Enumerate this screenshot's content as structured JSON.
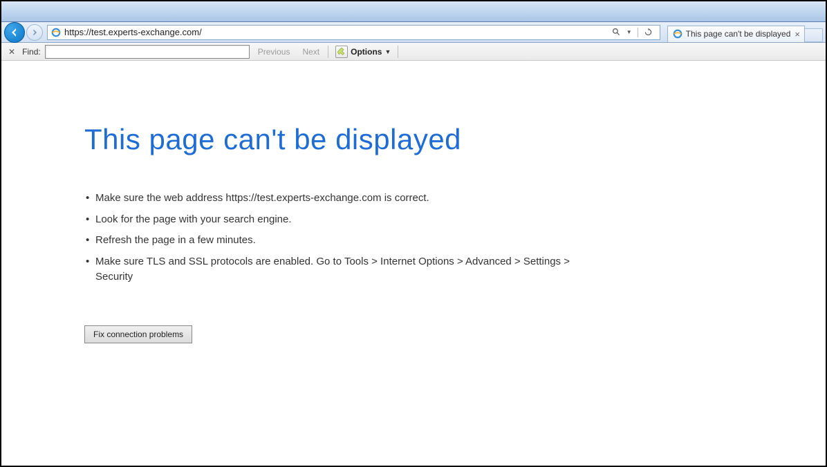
{
  "nav": {
    "url": "https://test.experts-exchange.com/"
  },
  "tab": {
    "title": "This page can't be displayed"
  },
  "findbar": {
    "label": "Find:",
    "previous": "Previous",
    "next": "Next",
    "options": "Options",
    "input_value": ""
  },
  "error": {
    "title": "This page can't be displayed",
    "bullets": [
      "Make sure the web address https://test.experts-exchange.com is correct.",
      "Look for the page with your search engine.",
      "Refresh the page in a few minutes.",
      "Make sure TLS and SSL protocols are enabled. Go to Tools > Internet Options > Advanced > Settings > Security"
    ],
    "fix_button": "Fix connection problems"
  }
}
